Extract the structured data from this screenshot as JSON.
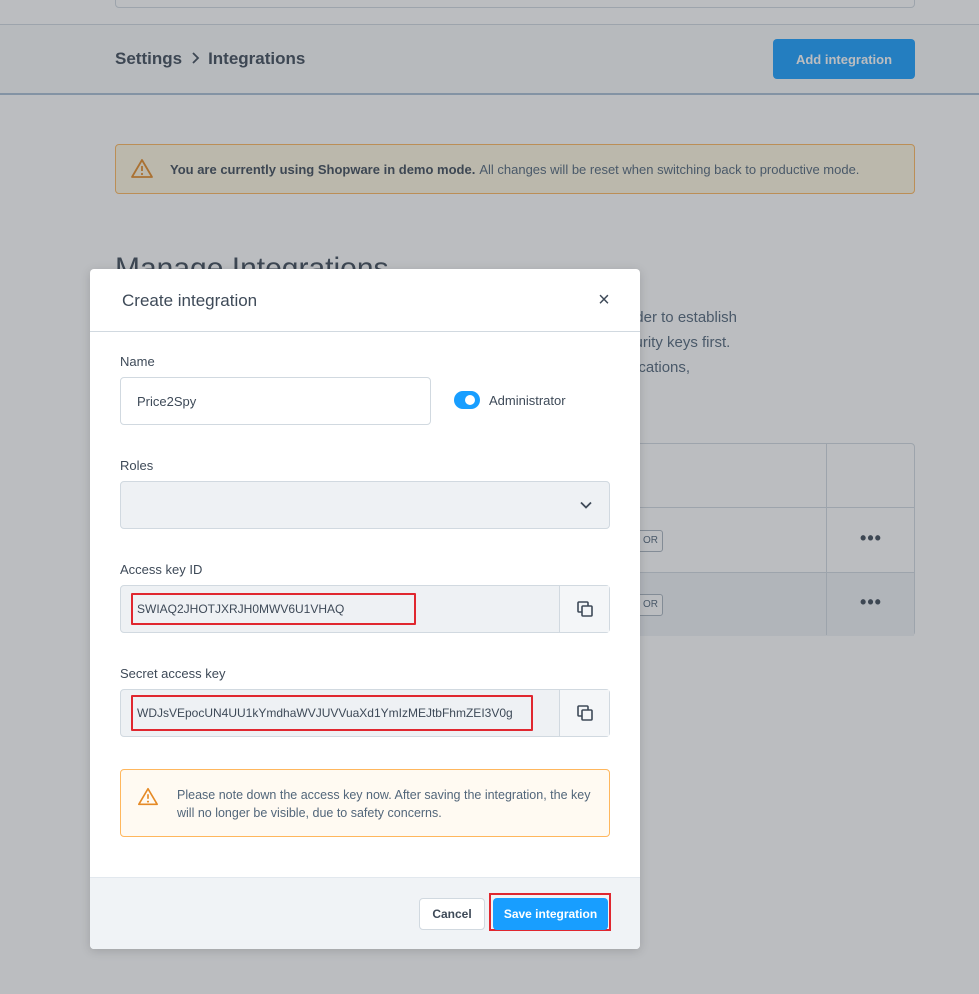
{
  "header": {
    "breadcrumb": [
      "Settings",
      "Integrations"
    ],
    "add_button_label": "Add integration"
  },
  "demo_alert": {
    "bold": "You are currently using Shopware in demo mode.",
    "text": "All changes will be reset when switching back to productive mode."
  },
  "manage": {
    "title": "Manage Integrations",
    "description_lines": [
      "Integrations allow you to connect external applications to your processes. In order to establish",
      "a connection, the external application must authenticate through individual security keys first.",
      "This way, you can control whether changes can be introduced by external applications,"
    ]
  },
  "table": {
    "badge_text": "OR",
    "more_label": "•••"
  },
  "modal": {
    "title": "Create integration",
    "close_label": "×",
    "name_label": "Name",
    "name_value": "Price2Spy",
    "admin_label": "Administrator",
    "admin_enabled": true,
    "roles_label": "Roles",
    "roles_value": "",
    "access_key_label": "Access key ID",
    "access_key_value": "SWIAQ2JHOTJXRJH0MWV6U1VHAQ",
    "secret_key_label": "Secret access key",
    "secret_key_value": "WDJsVEpocUN4UU1kYmdhaWVJUVVuaXd1YmIzMEJtbFhmZEI3V0g",
    "note": "Please note down the access key now. After saving the integration, the key will no longer be visible, due to safety concerns.",
    "cancel_label": "Cancel",
    "save_label": "Save integration"
  },
  "colors": {
    "primary": "#189eff",
    "warning_border": "#ffb75d",
    "highlight": "#e0272f"
  }
}
